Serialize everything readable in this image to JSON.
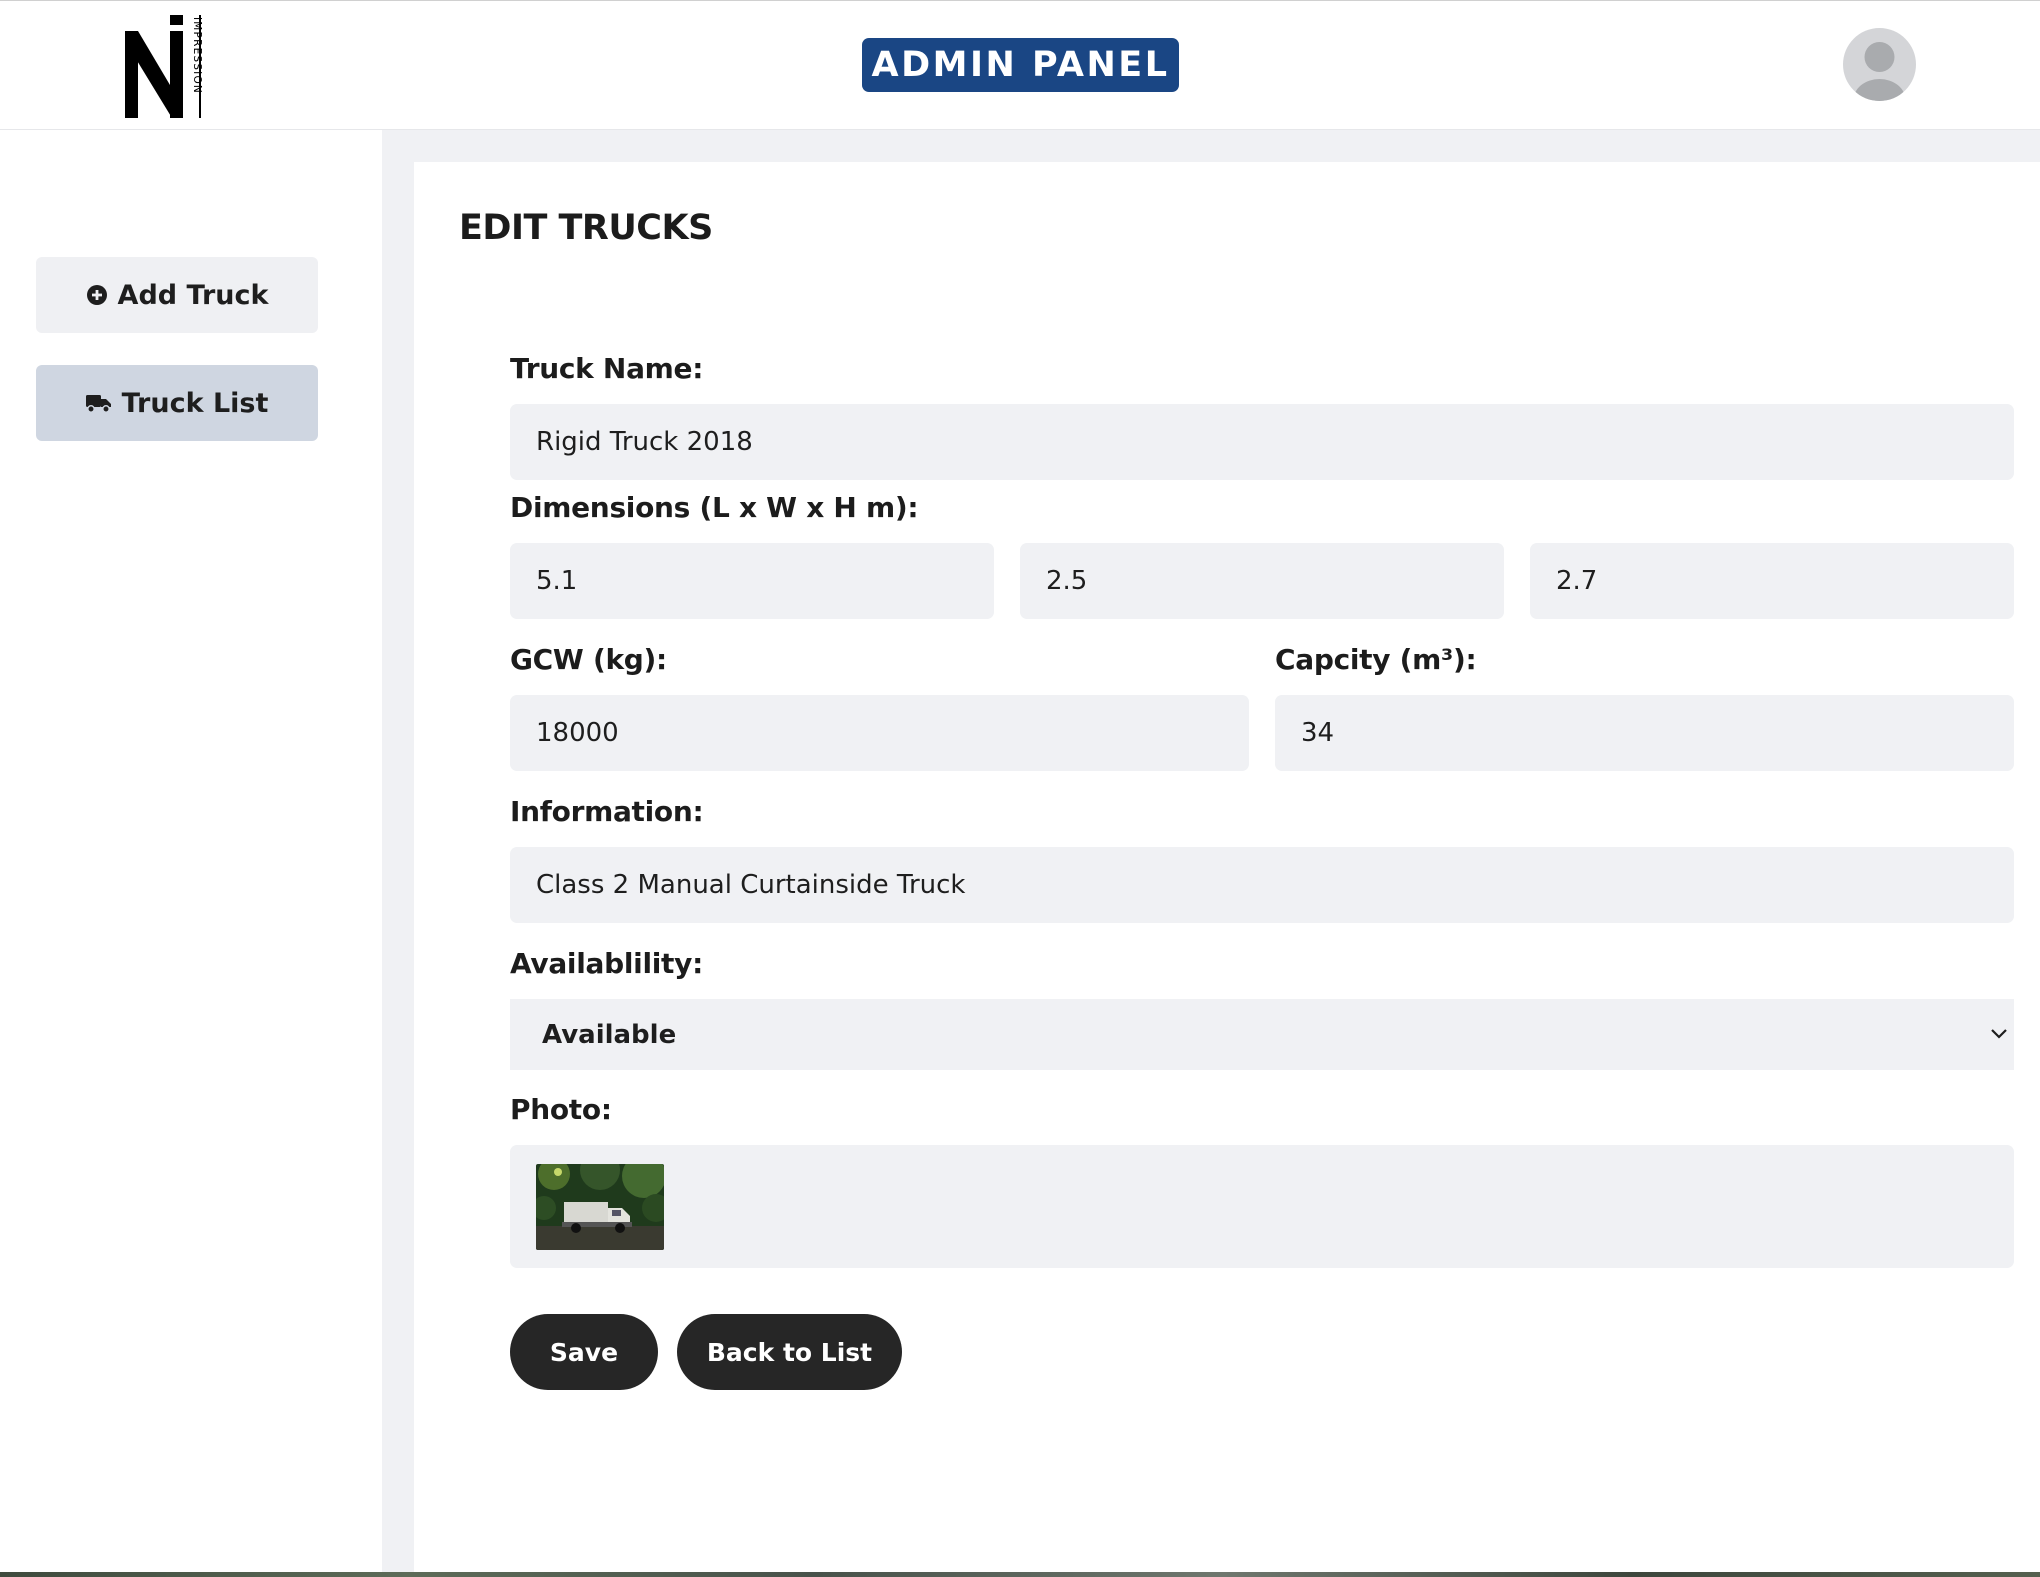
{
  "header": {
    "logo_text": "IMPRESSION",
    "badge": "ADMIN PANEL"
  },
  "sidebar": {
    "items": [
      {
        "label": "Add Truck",
        "icon": "plus-circle-icon",
        "active": false
      },
      {
        "label": "Truck List",
        "icon": "truck-icon",
        "active": true
      }
    ]
  },
  "main": {
    "title": "EDIT TRUCKS",
    "form": {
      "truck_name": {
        "label": "Truck Name:",
        "value": "Rigid Truck 2018"
      },
      "dimensions": {
        "label": "Dimensions (L x W x H m):",
        "length": "5.1",
        "width": "2.5",
        "height": "2.7"
      },
      "gcw": {
        "label": "GCW (kg):",
        "value": "18000"
      },
      "capacity": {
        "label": "Capcity (m³):",
        "value": "34"
      },
      "information": {
        "label": "Information:",
        "value": "Class 2 Manual Curtainside Truck"
      },
      "availability": {
        "label": "Availablility:",
        "selected": "Available",
        "icon": "chevron-down-icon"
      },
      "photo": {
        "label": "Photo:",
        "thumbnail": "truck-photo-thumbnail"
      }
    },
    "buttons": {
      "save": "Save",
      "back": "Back to List"
    }
  },
  "colors": {
    "brand_blue": "#1a4684",
    "input_bg": "#f0f1f4",
    "active_nav_bg": "#cfd6e1",
    "button_dark": "#262626"
  }
}
